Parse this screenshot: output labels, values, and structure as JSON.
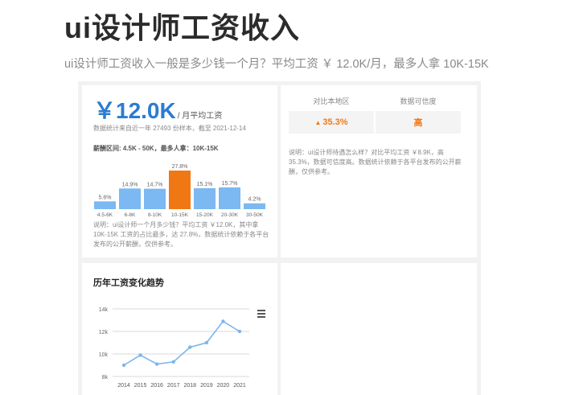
{
  "page": {
    "title": "ui设计师工资收入",
    "subtitle": "ui设计师工资收入一般是多少钱一个月？平均工资 ￥ 12.0K/月，最多人拿 10K-15K"
  },
  "salary_panel": {
    "amount": "￥12.0K",
    "unit": "/ 月平均工资",
    "source": "数据统计来自近一年 27493 份样本，截至 2021-12-14",
    "range_text": "薪酬区间: 4.5K - 50K，最多人拿：10K-15K",
    "note": "说明：ui设计师一个月多少钱？平均工资 ￥12.0K，其中拿 10K-15K 工资的占比最多，达 27.8%，数据统计依赖于各平台发布的公开薪酬，仅供参考。"
  },
  "compare_panel": {
    "local_label": "对比本地区",
    "local_value": "35.3%",
    "trust_label": "数据可信度",
    "trust_value": "高",
    "note": "说明：ui设计师待遇怎么样？对比平均工资 ￥8.9K，高 35.3%，数据可信度高。数据统计依赖于各平台发布的公开薪酬，仅供参考。"
  },
  "trend_panel": {
    "title": "历年工资变化趋势"
  },
  "colors": {
    "accent_blue": "#2a7cd3",
    "bar_blue": "#7cb8f2",
    "highlight_orange": "#f07814",
    "line_blue": "#7cb5ec"
  },
  "icons": {
    "up": "arrow-up-icon",
    "menu": "menu-icon"
  },
  "chart_data": [
    {
      "type": "bar",
      "categories": [
        "4.5-6K",
        "6-8K",
        "8-10K",
        "10-15K",
        "15-20K",
        "20-30K",
        "30-50K"
      ],
      "values": [
        5.6,
        14.9,
        14.7,
        27.8,
        15.1,
        15.7,
        4.2
      ],
      "value_labels": [
        "5.6%",
        "14.9%",
        "14.7%",
        "27.8%",
        "15.1%",
        "15.7%",
        "4.2%"
      ],
      "highlight_index": 3,
      "grid": false
    },
    {
      "type": "line",
      "x": [
        "2014",
        "2015",
        "2016",
        "2017",
        "2018",
        "2019",
        "2020",
        "2021"
      ],
      "values": [
        9.0,
        9.9,
        9.1,
        9.3,
        10.6,
        11.0,
        12.9,
        12.0
      ],
      "y_ticks": [
        "8k",
        "10k",
        "12k",
        "14k"
      ],
      "ylim": [
        8,
        14
      ],
      "grid": true
    }
  ]
}
